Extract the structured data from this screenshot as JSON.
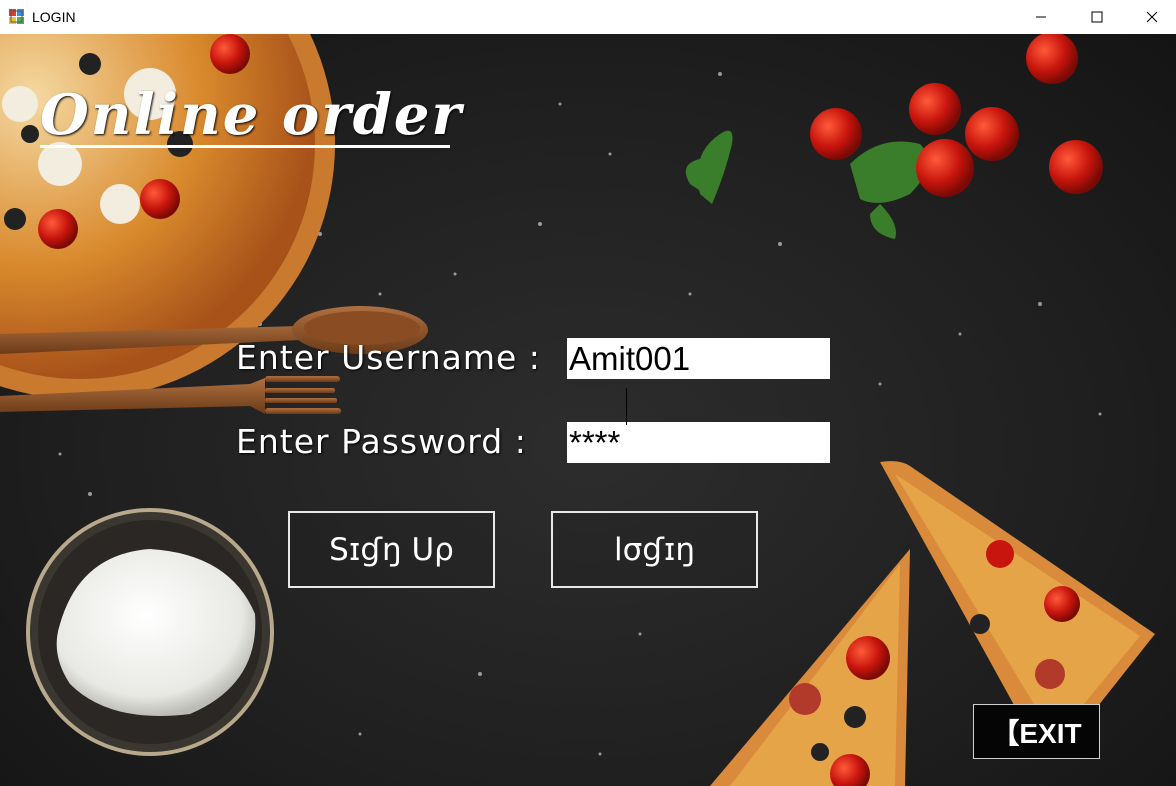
{
  "window": {
    "title": "LOGIN",
    "controls": {
      "minimize": "minimize-icon",
      "maximize": "maximize-icon",
      "close": "close-icon"
    }
  },
  "form": {
    "heading": "Online order",
    "username_label": "Enter Username :",
    "username_value": "Amit001",
    "password_label": "Enter Password :",
    "password_value": "****",
    "signup_label": "Sɪɠŋ Uρ",
    "login_label": "lσɠɪŋ",
    "exit_label": "【EXIT"
  },
  "colors": {
    "background": "#1f1f1f",
    "text": "#ffffff",
    "field": "#ffffff",
    "tomato": "#c8150d",
    "crust": "#d9893a"
  }
}
